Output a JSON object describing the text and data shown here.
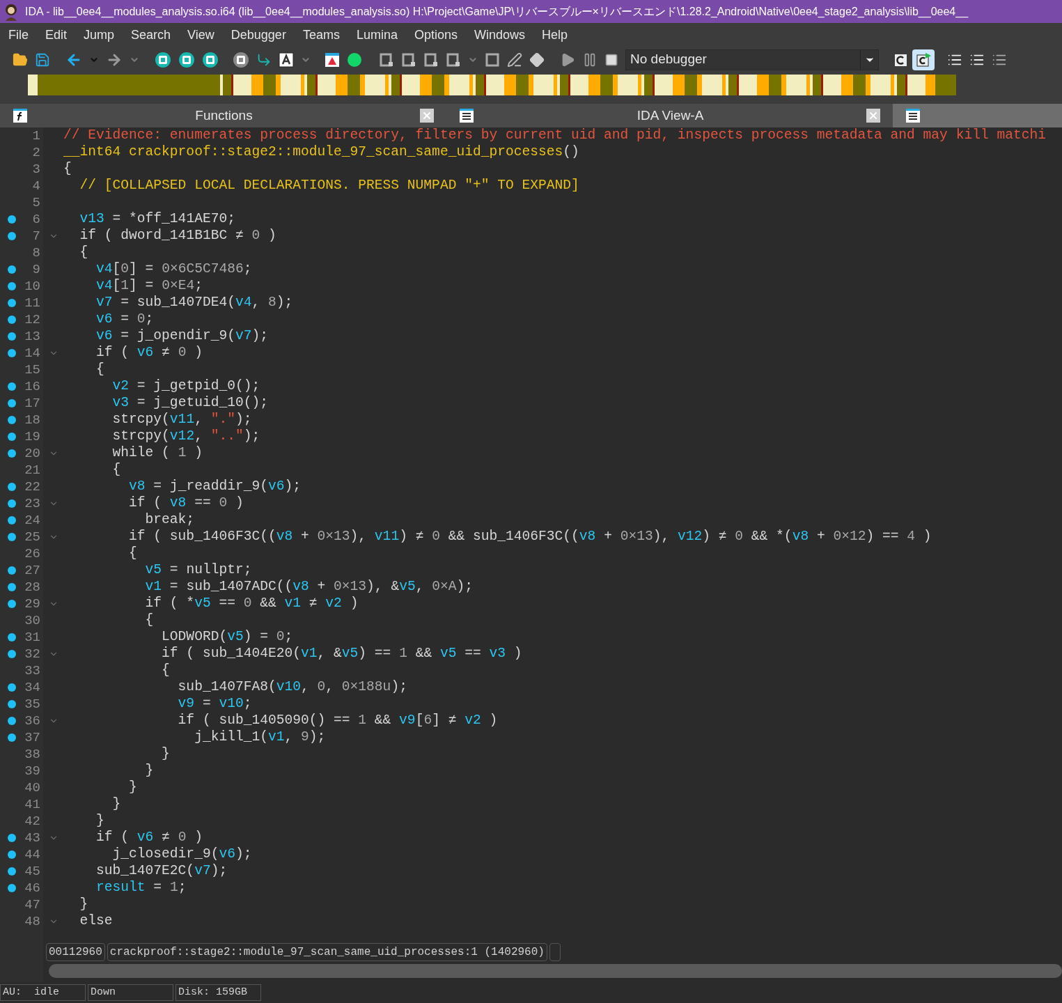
{
  "window": {
    "title": "IDA - lib__0ee4__modules_analysis.so.i64 (lib__0ee4__modules_analysis.so) H:\\Project\\Game\\JP\\リバースブルー×リバースエンド\\1.28.2_Android\\Native\\0ee4_stage2_analysis\\lib__0ee4__"
  },
  "menu": [
    "File",
    "Edit",
    "Jump",
    "Search",
    "View",
    "Debugger",
    "Teams",
    "Lumina",
    "Options",
    "Windows",
    "Help"
  ],
  "toolbar": {
    "debugger": "No debugger"
  },
  "tabs": [
    {
      "label": "Functions",
      "selected": false,
      "closable": true
    },
    {
      "label": "IDA View-A",
      "selected": false,
      "closable": true
    },
    {
      "selected": true,
      "closable": false
    }
  ],
  "code": {
    "lines": [
      {
        "number": "1",
        "dot": false,
        "fold": false,
        "segments": [
          {
            "kind": "comment",
            "text": "// Evidence: enumerates process directory, filters by current uid and pid, inspects process metadata and may kill matchi"
          }
        ]
      },
      {
        "number": "2",
        "dot": false,
        "fold": false,
        "segments": [
          {
            "kind": "note",
            "text": "__int64 crackproof::stage2::module_97_scan_same_uid_processes"
          },
          {
            "kind": "plain",
            "text": "()"
          }
        ]
      },
      {
        "number": "3",
        "dot": false,
        "fold": false,
        "segments": [
          {
            "kind": "plain",
            "text": "{"
          }
        ]
      },
      {
        "number": "4",
        "dot": false,
        "fold": false,
        "segments": [
          {
            "kind": "note",
            "text": "  // [COLLAPSED LOCAL DECLARATIONS. PRESS NUMPAD \"+\" TO EXPAND]"
          }
        ]
      },
      {
        "number": "5",
        "dot": false,
        "fold": false
      },
      {
        "number": "6",
        "dot": true,
        "fold": false,
        "segments": [
          {
            "kind": "var",
            "text": "  v13"
          },
          {
            "kind": "plain",
            "text": " = *off_141AE70;"
          }
        ]
      },
      {
        "number": "7",
        "dot": true,
        "fold": true,
        "segments": [
          {
            "kind": "plain",
            "text": "  if ( dword_141B1BC ≠ "
          },
          {
            "kind": "num",
            "text": "0"
          },
          {
            "kind": "plain",
            "text": " )"
          }
        ]
      },
      {
        "number": "8",
        "dot": false,
        "fold": false,
        "segments": [
          {
            "kind": "plain",
            "text": "  {"
          }
        ]
      },
      {
        "number": "9",
        "dot": true,
        "fold": false,
        "segments": [
          {
            "kind": "var",
            "text": "    v4"
          },
          {
            "kind": "plain",
            "text": "["
          },
          {
            "kind": "num",
            "text": "0"
          },
          {
            "kind": "plain",
            "text": "] = "
          },
          {
            "kind": "num",
            "text": "0×6C5C7486"
          },
          {
            "kind": "plain",
            "text": ";"
          }
        ]
      },
      {
        "number": "10",
        "dot": true,
        "fold": false,
        "segments": [
          {
            "kind": "var",
            "text": "    v4"
          },
          {
            "kind": "plain",
            "text": "["
          },
          {
            "kind": "num",
            "text": "1"
          },
          {
            "kind": "plain",
            "text": "] = "
          },
          {
            "kind": "num",
            "text": "0×E4"
          },
          {
            "kind": "plain",
            "text": ";"
          }
        ]
      },
      {
        "number": "11",
        "dot": true,
        "fold": false,
        "segments": [
          {
            "kind": "var",
            "text": "    v7"
          },
          {
            "kind": "plain",
            "text": " = sub_1407DE4("
          },
          {
            "kind": "var",
            "text": "v4"
          },
          {
            "kind": "plain",
            "text": ", "
          },
          {
            "kind": "num",
            "text": "8"
          },
          {
            "kind": "plain",
            "text": ");"
          }
        ]
      },
      {
        "number": "12",
        "dot": true,
        "fold": false,
        "segments": [
          {
            "kind": "var",
            "text": "    v6"
          },
          {
            "kind": "plain",
            "text": " = "
          },
          {
            "kind": "num",
            "text": "0"
          },
          {
            "kind": "plain",
            "text": ";"
          }
        ]
      },
      {
        "number": "13",
        "dot": true,
        "fold": false,
        "segments": [
          {
            "kind": "var",
            "text": "    v6"
          },
          {
            "kind": "plain",
            "text": " = j_opendir_9("
          },
          {
            "kind": "var",
            "text": "v7"
          },
          {
            "kind": "plain",
            "text": ");"
          }
        ]
      },
      {
        "number": "14",
        "dot": true,
        "fold": true,
        "segments": [
          {
            "kind": "plain",
            "text": "    if ( "
          },
          {
            "kind": "var",
            "text": "v6"
          },
          {
            "kind": "plain",
            "text": " ≠ "
          },
          {
            "kind": "num",
            "text": "0"
          },
          {
            "kind": "plain",
            "text": " )"
          }
        ]
      },
      {
        "number": "15",
        "dot": false,
        "fold": false,
        "segments": [
          {
            "kind": "plain",
            "text": "    {"
          }
        ]
      },
      {
        "number": "16",
        "dot": true,
        "fold": false,
        "segments": [
          {
            "kind": "var",
            "text": "      v2"
          },
          {
            "kind": "plain",
            "text": " = j_getpid_0();"
          }
        ]
      },
      {
        "number": "17",
        "dot": true,
        "fold": false,
        "segments": [
          {
            "kind": "var",
            "text": "      v3"
          },
          {
            "kind": "plain",
            "text": " = j_getuid_10();"
          }
        ]
      },
      {
        "number": "18",
        "dot": true,
        "fold": false,
        "segments": [
          {
            "kind": "plain",
            "text": "      strcpy("
          },
          {
            "kind": "var",
            "text": "v11"
          },
          {
            "kind": "plain",
            "text": ", "
          },
          {
            "kind": "str",
            "text": "\".\""
          },
          {
            "kind": "plain",
            "text": ");"
          }
        ]
      },
      {
        "number": "19",
        "dot": true,
        "fold": false,
        "segments": [
          {
            "kind": "plain",
            "text": "      strcpy("
          },
          {
            "kind": "var",
            "text": "v12"
          },
          {
            "kind": "plain",
            "text": ", "
          },
          {
            "kind": "str",
            "text": "\"..\""
          },
          {
            "kind": "plain",
            "text": ");"
          }
        ]
      },
      {
        "number": "20",
        "dot": true,
        "fold": true,
        "segments": [
          {
            "kind": "plain",
            "text": "      while ( "
          },
          {
            "kind": "num",
            "text": "1"
          },
          {
            "kind": "plain",
            "text": " )"
          }
        ]
      },
      {
        "number": "21",
        "dot": false,
        "fold": false,
        "segments": [
          {
            "kind": "plain",
            "text": "      {"
          }
        ]
      },
      {
        "number": "22",
        "dot": true,
        "fold": false,
        "segments": [
          {
            "kind": "var",
            "text": "        v8"
          },
          {
            "kind": "plain",
            "text": " = j_readdir_9("
          },
          {
            "kind": "var",
            "text": "v6"
          },
          {
            "kind": "plain",
            "text": ");"
          }
        ]
      },
      {
        "number": "23",
        "dot": true,
        "fold": true,
        "segments": [
          {
            "kind": "plain",
            "text": "        if ( "
          },
          {
            "kind": "var",
            "text": "v8"
          },
          {
            "kind": "plain",
            "text": " == "
          },
          {
            "kind": "num",
            "text": "0"
          },
          {
            "kind": "plain",
            "text": " )"
          }
        ]
      },
      {
        "number": "24",
        "dot": true,
        "fold": false,
        "segments": [
          {
            "kind": "plain",
            "text": "          break;"
          }
        ]
      },
      {
        "number": "25",
        "dot": true,
        "fold": true,
        "segments": [
          {
            "kind": "plain",
            "text": "        if ( sub_1406F3C(("
          },
          {
            "kind": "var",
            "text": "v8"
          },
          {
            "kind": "plain",
            "text": " + "
          },
          {
            "kind": "num",
            "text": "0×13"
          },
          {
            "kind": "plain",
            "text": "), "
          },
          {
            "kind": "var",
            "text": "v11"
          },
          {
            "kind": "plain",
            "text": ") ≠ "
          },
          {
            "kind": "num",
            "text": "0"
          },
          {
            "kind": "plain",
            "text": " && sub_1406F3C(("
          },
          {
            "kind": "var",
            "text": "v8"
          },
          {
            "kind": "plain",
            "text": " + "
          },
          {
            "kind": "num",
            "text": "0×13"
          },
          {
            "kind": "plain",
            "text": "), "
          },
          {
            "kind": "var",
            "text": "v12"
          },
          {
            "kind": "plain",
            "text": ") ≠ "
          },
          {
            "kind": "num",
            "text": "0"
          },
          {
            "kind": "plain",
            "text": " && *("
          },
          {
            "kind": "var",
            "text": "v8"
          },
          {
            "kind": "plain",
            "text": " + "
          },
          {
            "kind": "num",
            "text": "0×12"
          },
          {
            "kind": "plain",
            "text": ") == "
          },
          {
            "kind": "num",
            "text": "4"
          },
          {
            "kind": "plain",
            "text": " )"
          }
        ]
      },
      {
        "number": "26",
        "dot": false,
        "fold": false,
        "segments": [
          {
            "kind": "plain",
            "text": "        {"
          }
        ]
      },
      {
        "number": "27",
        "dot": true,
        "fold": false,
        "segments": [
          {
            "kind": "var",
            "text": "          v5"
          },
          {
            "kind": "plain",
            "text": " = nullptr;"
          }
        ]
      },
      {
        "number": "28",
        "dot": true,
        "fold": false,
        "segments": [
          {
            "kind": "var",
            "text": "          v1"
          },
          {
            "kind": "plain",
            "text": " = sub_1407ADC(("
          },
          {
            "kind": "var",
            "text": "v8"
          },
          {
            "kind": "plain",
            "text": " + "
          },
          {
            "kind": "num",
            "text": "0×13"
          },
          {
            "kind": "plain",
            "text": "), &"
          },
          {
            "kind": "var",
            "text": "v5"
          },
          {
            "kind": "plain",
            "text": ", "
          },
          {
            "kind": "num",
            "text": "0×A"
          },
          {
            "kind": "plain",
            "text": ");"
          }
        ]
      },
      {
        "number": "29",
        "dot": true,
        "fold": true,
        "segments": [
          {
            "kind": "plain",
            "text": "          if ( *"
          },
          {
            "kind": "var",
            "text": "v5"
          },
          {
            "kind": "plain",
            "text": " == "
          },
          {
            "kind": "num",
            "text": "0"
          },
          {
            "kind": "plain",
            "text": " && "
          },
          {
            "kind": "var",
            "text": "v1"
          },
          {
            "kind": "plain",
            "text": " ≠ "
          },
          {
            "kind": "var",
            "text": "v2"
          },
          {
            "kind": "plain",
            "text": " )"
          }
        ]
      },
      {
        "number": "30",
        "dot": false,
        "fold": false,
        "segments": [
          {
            "kind": "plain",
            "text": "          {"
          }
        ]
      },
      {
        "number": "31",
        "dot": true,
        "fold": false,
        "segments": [
          {
            "kind": "plain",
            "text": "            LODWORD("
          },
          {
            "kind": "var",
            "text": "v5"
          },
          {
            "kind": "plain",
            "text": ") = "
          },
          {
            "kind": "num",
            "text": "0"
          },
          {
            "kind": "plain",
            "text": ";"
          }
        ]
      },
      {
        "number": "32",
        "dot": true,
        "fold": true,
        "segments": [
          {
            "kind": "plain",
            "text": "            if ( sub_1404E20("
          },
          {
            "kind": "var",
            "text": "v1"
          },
          {
            "kind": "plain",
            "text": ", &"
          },
          {
            "kind": "var",
            "text": "v5"
          },
          {
            "kind": "plain",
            "text": ") == "
          },
          {
            "kind": "num",
            "text": "1"
          },
          {
            "kind": "plain",
            "text": " && "
          },
          {
            "kind": "var",
            "text": "v5"
          },
          {
            "kind": "plain",
            "text": " == "
          },
          {
            "kind": "var",
            "text": "v3"
          },
          {
            "kind": "plain",
            "text": " )"
          }
        ]
      },
      {
        "number": "33",
        "dot": false,
        "fold": false,
        "segments": [
          {
            "kind": "plain",
            "text": "            {"
          }
        ]
      },
      {
        "number": "34",
        "dot": true,
        "fold": false,
        "segments": [
          {
            "kind": "plain",
            "text": "              sub_1407FA8("
          },
          {
            "kind": "var",
            "text": "v10"
          },
          {
            "kind": "plain",
            "text": ", "
          },
          {
            "kind": "num",
            "text": "0"
          },
          {
            "kind": "plain",
            "text": ", "
          },
          {
            "kind": "num",
            "text": "0×188u"
          },
          {
            "kind": "plain",
            "text": ");"
          }
        ]
      },
      {
        "number": "35",
        "dot": true,
        "fold": false,
        "segments": [
          {
            "kind": "var",
            "text": "              v9"
          },
          {
            "kind": "plain",
            "text": " = "
          },
          {
            "kind": "var",
            "text": "v10"
          },
          {
            "kind": "plain",
            "text": ";"
          }
        ]
      },
      {
        "number": "36",
        "dot": true,
        "fold": true,
        "segments": [
          {
            "kind": "plain",
            "text": "              if ( sub_1405090() == "
          },
          {
            "kind": "num",
            "text": "1"
          },
          {
            "kind": "plain",
            "text": " && "
          },
          {
            "kind": "var",
            "text": "v9"
          },
          {
            "kind": "plain",
            "text": "["
          },
          {
            "kind": "num",
            "text": "6"
          },
          {
            "kind": "plain",
            "text": "] ≠ "
          },
          {
            "kind": "var",
            "text": "v2"
          },
          {
            "kind": "plain",
            "text": " )"
          }
        ]
      },
      {
        "number": "37",
        "dot": true,
        "fold": false,
        "segments": [
          {
            "kind": "plain",
            "text": "                j_kill_1("
          },
          {
            "kind": "var",
            "text": "v1"
          },
          {
            "kind": "plain",
            "text": ", "
          },
          {
            "kind": "num",
            "text": "9"
          },
          {
            "kind": "plain",
            "text": ");"
          }
        ]
      },
      {
        "number": "38",
        "dot": false,
        "fold": false,
        "segments": [
          {
            "kind": "plain",
            "text": "            }"
          }
        ]
      },
      {
        "number": "39",
        "dot": false,
        "fold": false,
        "segments": [
          {
            "kind": "plain",
            "text": "          }"
          }
        ]
      },
      {
        "number": "40",
        "dot": false,
        "fold": false,
        "segments": [
          {
            "kind": "plain",
            "text": "        }"
          }
        ]
      },
      {
        "number": "41",
        "dot": false,
        "fold": false,
        "segments": [
          {
            "kind": "plain",
            "text": "      }"
          }
        ]
      },
      {
        "number": "42",
        "dot": false,
        "fold": false,
        "segments": [
          {
            "kind": "plain",
            "text": "    }"
          }
        ]
      },
      {
        "number": "43",
        "dot": true,
        "fold": true,
        "segments": [
          {
            "kind": "plain",
            "text": "    if ( "
          },
          {
            "kind": "var",
            "text": "v6"
          },
          {
            "kind": "plain",
            "text": " ≠ "
          },
          {
            "kind": "num",
            "text": "0"
          },
          {
            "kind": "plain",
            "text": " )"
          }
        ]
      },
      {
        "number": "44",
        "dot": true,
        "fold": false,
        "segments": [
          {
            "kind": "plain",
            "text": "      j_closedir_9("
          },
          {
            "kind": "var",
            "text": "v6"
          },
          {
            "kind": "plain",
            "text": ");"
          }
        ]
      },
      {
        "number": "45",
        "dot": true,
        "fold": false,
        "segments": [
          {
            "kind": "plain",
            "text": "    sub_1407E2C("
          },
          {
            "kind": "var",
            "text": "v7"
          },
          {
            "kind": "plain",
            "text": ");"
          }
        ]
      },
      {
        "number": "46",
        "dot": true,
        "fold": false,
        "segments": [
          {
            "kind": "var",
            "text": "    result"
          },
          {
            "kind": "plain",
            "text": " = "
          },
          {
            "kind": "num",
            "text": "1"
          },
          {
            "kind": "plain",
            "text": ";"
          }
        ]
      },
      {
        "number": "47",
        "dot": false,
        "fold": false,
        "segments": [
          {
            "kind": "plain",
            "text": "  }"
          }
        ]
      },
      {
        "number": "48",
        "dot": false,
        "fold": true,
        "segments": [
          {
            "kind": "plain",
            "text": "  else"
          }
        ]
      }
    ]
  },
  "location": {
    "address": "00112960",
    "function": "crackproof::stage2::module_97_scan_same_uid_processes:1 (1402960)"
  },
  "status_bar": [
    "AU:  idle",
    "Down",
    "Disk: 159GB"
  ]
}
